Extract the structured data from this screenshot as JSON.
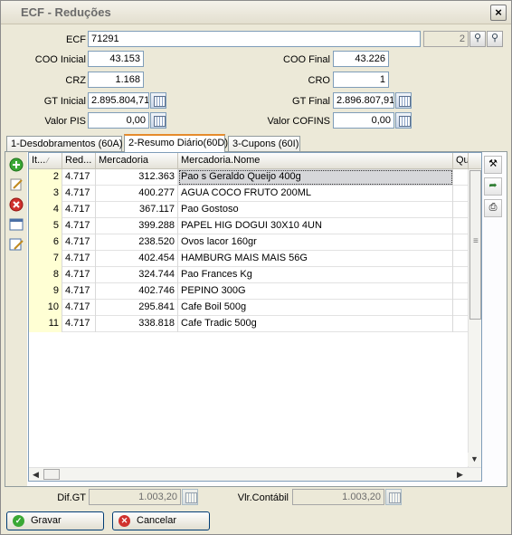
{
  "window": {
    "title": "ECF - Reduções"
  },
  "header": {
    "ecf_label": "ECF",
    "ecf_value": "71291",
    "ecf_number": "2",
    "coo_inicial_label": "COO Inicial",
    "coo_inicial": "43.153",
    "coo_final_label": "COO Final",
    "coo_final": "43.226",
    "crz_label": "CRZ",
    "crz": "1.168",
    "cro_label": "CRO",
    "cro": "1",
    "gt_inicial_label": "GT Inicial",
    "gt_inicial": "2.895.804,71",
    "gt_final_label": "GT Final",
    "gt_final": "2.896.807,91",
    "valor_pis_label": "Valor PIS",
    "valor_pis": "0,00",
    "valor_cofins_label": "Valor COFINS",
    "valor_cofins": "0,00"
  },
  "tabs": [
    {
      "label": "1-Desdobramentos (60A)"
    },
    {
      "label": "2-Resumo Diário(60D)"
    },
    {
      "label": "3-Cupons (60I)"
    }
  ],
  "grid": {
    "columns": [
      "It...",
      "Red...",
      "Mercadoria",
      "Mercadoria.Nome",
      "Qu"
    ],
    "rows": [
      [
        "2",
        "4.717",
        "312.363",
        "Pao s Geraldo Queijo 400g"
      ],
      [
        "3",
        "4.717",
        "400.277",
        "AGUA COCO  FRUTO 200ML"
      ],
      [
        "4",
        "4.717",
        "367.117",
        "Pao Gostoso"
      ],
      [
        "5",
        "4.717",
        "399.288",
        "PAPEL HIG DOGUI 30X10 4UN"
      ],
      [
        "6",
        "4.717",
        "238.520",
        "Ovos lacor 160gr"
      ],
      [
        "7",
        "4.717",
        "402.454",
        "HAMBURG MAIS MAIS  56G"
      ],
      [
        "8",
        "4.717",
        "324.744",
        "Pao Frances Kg"
      ],
      [
        "9",
        "4.717",
        "402.746",
        "PEPINO  300G"
      ],
      [
        "10",
        "4.717",
        "295.841",
        "Cafe Boil 500g"
      ],
      [
        "11",
        "4.717",
        "338.818",
        "Cafe Tradic 500g"
      ]
    ]
  },
  "footer": {
    "dif_gt_label": "Dif.GT",
    "dif_gt": "1.003,20",
    "vlr_contabil_label": "Vlr.Contábil",
    "vlr_contabil": "1.003,20",
    "gravar_label": "Gravar",
    "cancelar_label": "Cancelar"
  },
  "colors": {
    "tab_accent": "#e68b2c",
    "key_column_bg": "#ffffd4",
    "border_blue": "#7f9db9",
    "add_green": "#3aa835",
    "delete_red": "#d0312d"
  }
}
